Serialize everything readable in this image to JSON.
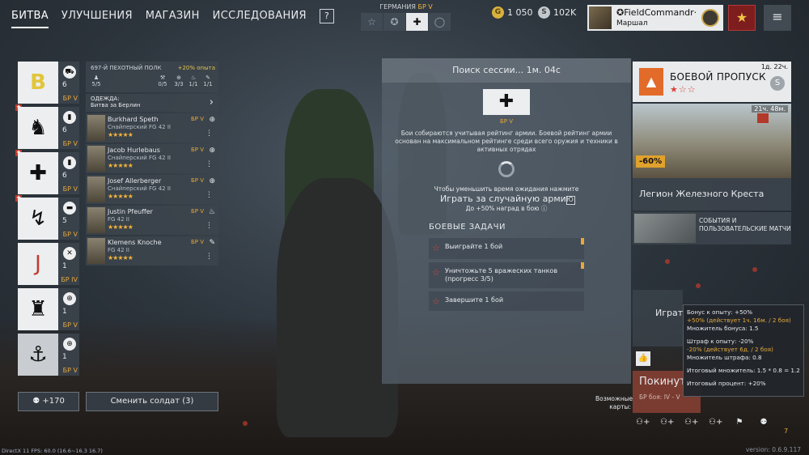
{
  "nav": {
    "tabs": [
      "БИТВА",
      "УЛУЧШЕНИЯ",
      "МАГАЗИН",
      "ИССЛЕДОВАНИЯ"
    ],
    "help": "?"
  },
  "nation": {
    "label": "ГЕРМАНИЯ",
    "br": "БР V"
  },
  "currency": {
    "gold": "1 050",
    "silver": "102K"
  },
  "profile": {
    "name": "✪FieldCommandr·",
    "rank": "Маршал"
  },
  "squads": [
    {
      "emblem": "B",
      "count": "6",
      "br": "БР V",
      "icon": "◉"
    },
    {
      "emblem": "♞",
      "count": "6",
      "br": "БР V",
      "icon": "◉"
    },
    {
      "emblem": "✚",
      "count": "6",
      "br": "БР V",
      "icon": "◉"
    },
    {
      "emblem": "↯",
      "count": "5",
      "br": "БР V",
      "icon": "◉"
    },
    {
      "emblem": "J",
      "count": "1",
      "br": "БР IV",
      "icon": "◉"
    },
    {
      "emblem": "♜",
      "count": "1",
      "br": "БР V",
      "icon": "◉"
    },
    {
      "emblem": "⚓",
      "count": "1",
      "br": "БР V",
      "icon": "◉"
    }
  ],
  "squad_panel": {
    "name": "697-Й ПЕХОТНЫЙ ПОЛК",
    "xp_bonus": "+20% опыта",
    "stats": [
      "5/5",
      "0/5",
      "3/3",
      "1/1",
      "1/1"
    ],
    "outfit_label": "ОДЕЖДА:",
    "outfit_value": "Битва за Берлин",
    "soldiers": [
      {
        "name": "Burkhard Speth",
        "cls": "Снайперский FG 42 II",
        "br": "БР V",
        "stars": "★★★★★"
      },
      {
        "name": "Jacob Hurlebaus",
        "cls": "Снайперский FG 42 II",
        "br": "БР V",
        "stars": "★★★★★"
      },
      {
        "name": "Josef Allerberger",
        "cls": "Снайперский FG 42 II",
        "br": "БР V",
        "stars": "★★★★★"
      },
      {
        "name": "Justin Pfeuffer",
        "cls": "FG 42 II",
        "br": "БР V",
        "stars": "★★★★★"
      },
      {
        "name": "Klemens Knoche",
        "cls": "FG 42 II",
        "br": "БР V",
        "stars": "★★★★★"
      }
    ]
  },
  "bottom_left": {
    "friends": "+170",
    "change_soldier": "Сменить солдат (3)"
  },
  "session": {
    "title": "Поиск сессии... 1м. 04с",
    "br": "БР V",
    "desc": "Бои собираются учитывая рейтинг армии. Боевой рейтинг армии основан на максимальном рейтинге среди всего оружия и техники в активных отрядах",
    "hint": "Чтобы уменьшить время ожидания нажмите",
    "random_army": "Играть за случайную армию",
    "bonus": "До +50% наград в бою",
    "tasks_title": "БОЕВЫЕ ЗАДАЧИ",
    "tasks": [
      "Выиграйте 1 бой",
      "Уничтожьте 5 вражеских танков (прогресс 3/5)",
      "Завершите 1 бой"
    ]
  },
  "right": {
    "bp_timer": "1д. 22ч.",
    "bp_title": "БОЕВОЙ ПРОПУСК",
    "bp_stars": "★☆☆",
    "promo_timer": "21ч. 48м.",
    "promo_discount": "-60%",
    "legion": "Легион Железного Креста",
    "events": "СОБЫТИЯ И ПОЛЬЗОВАТЕЛЬСКИЕ МАТЧИ",
    "play_label": "Играт",
    "leave_label": "Покинут",
    "leave_br": "БР боя: IV - V",
    "modes_label": "Возможные карты:",
    "squad_count": "7"
  },
  "tooltip": {
    "l1": "Бонус к опыту: +50%",
    "l2": "+50% (действует 1ч. 16м. / 2 боя)",
    "l3": "Множитель бонуса: 1.5",
    "l4": "Штраф к опыту: -20%",
    "l5": "-20% (действует 6д. / 2 боя)",
    "l6": "Множитель штрафа: 0.8",
    "l7": "Итоговый множитель: 1.5 * 0.8 = 1.2",
    "l8": "Итоговый процент: +20%"
  },
  "footer": {
    "fps": "DirectX 11 FPS: 60.0 (16.6~16.3 16.7)",
    "version": "version: 0.6.9.117"
  }
}
